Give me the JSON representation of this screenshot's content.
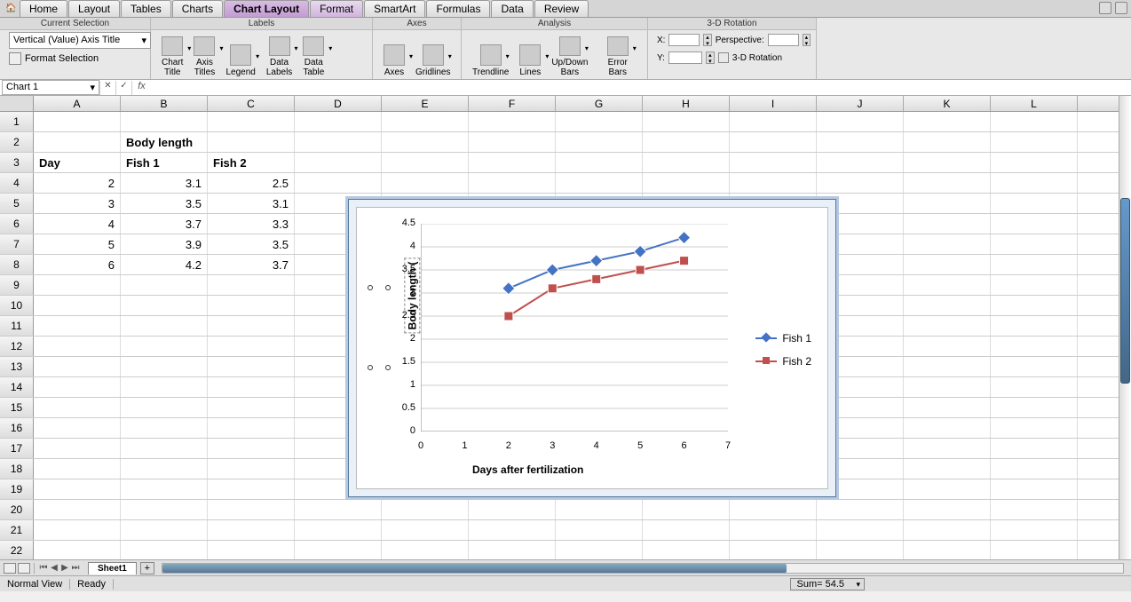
{
  "menu": {
    "home": "Home",
    "layout": "Layout",
    "tables": "Tables",
    "charts": "Charts",
    "chart_layout": "Chart Layout",
    "format": "Format",
    "smartart": "SmartArt",
    "formulas": "Formulas",
    "data": "Data",
    "review": "Review"
  },
  "ribbon": {
    "groups": {
      "selection": "Current Selection",
      "labels": "Labels",
      "axes": "Axes",
      "analysis": "Analysis",
      "rotation": "3-D Rotation"
    },
    "selection_dropdown": "Vertical (Value) Axis Title",
    "format_selection": "Format Selection",
    "buttons": {
      "chart_title": "Chart\nTitle",
      "axis_titles": "Axis\nTitles",
      "legend": "Legend",
      "data_labels": "Data\nLabels",
      "data_table": "Data\nTable",
      "axes_btn": "Axes",
      "gridlines": "Gridlines",
      "trendline": "Trendline",
      "lines": "Lines",
      "updown": "Up/Down\nBars",
      "error_bars": "Error Bars"
    },
    "rotation": {
      "x": "X:",
      "y": "Y:",
      "perspective": "Perspective:",
      "three_d": "3-D Rotation"
    }
  },
  "namebox": "Chart 1",
  "fx": "fx",
  "columns": [
    "A",
    "B",
    "C",
    "D",
    "E",
    "F",
    "G",
    "H",
    "I",
    "J",
    "K",
    "L"
  ],
  "sheet": {
    "headers": {
      "day": "Day",
      "body_length": "Body length",
      "fish1": "Fish 1",
      "fish2": "Fish 2"
    },
    "rows": [
      {
        "day": 2,
        "f1": 3.1,
        "f2": 2.5
      },
      {
        "day": 3,
        "f1": 3.5,
        "f2": 3.1
      },
      {
        "day": 4,
        "f1": 3.7,
        "f2": 3.3
      },
      {
        "day": 5,
        "f1": 3.9,
        "f2": 3.5
      },
      {
        "day": 6,
        "f1": 4.2,
        "f2": 3.7
      }
    ]
  },
  "chart_data": {
    "type": "line",
    "x": [
      2,
      3,
      4,
      5,
      6
    ],
    "series": [
      {
        "name": "Fish 1",
        "values": [
          3.1,
          3.5,
          3.7,
          3.9,
          4.2
        ],
        "color": "#4472C4",
        "marker": "diamond"
      },
      {
        "name": "Fish 2",
        "values": [
          2.5,
          3.1,
          3.3,
          3.5,
          3.7
        ],
        "color": "#C0504D",
        "marker": "square"
      }
    ],
    "xlabel": "Days after fertilization",
    "ylabel": "Body length (",
    "xlim": [
      0,
      7
    ],
    "ylim": [
      0,
      4.5
    ],
    "xticks": [
      0,
      1,
      2,
      3,
      4,
      5,
      6,
      7
    ],
    "yticks": [
      0,
      0.5,
      1,
      1.5,
      2,
      2.5,
      3,
      3.5,
      4,
      4.5
    ]
  },
  "tabs": {
    "sheet1": "Sheet1",
    "add": "+"
  },
  "status": {
    "view": "Normal View",
    "ready": "Ready",
    "sum": "Sum= 54.5"
  }
}
